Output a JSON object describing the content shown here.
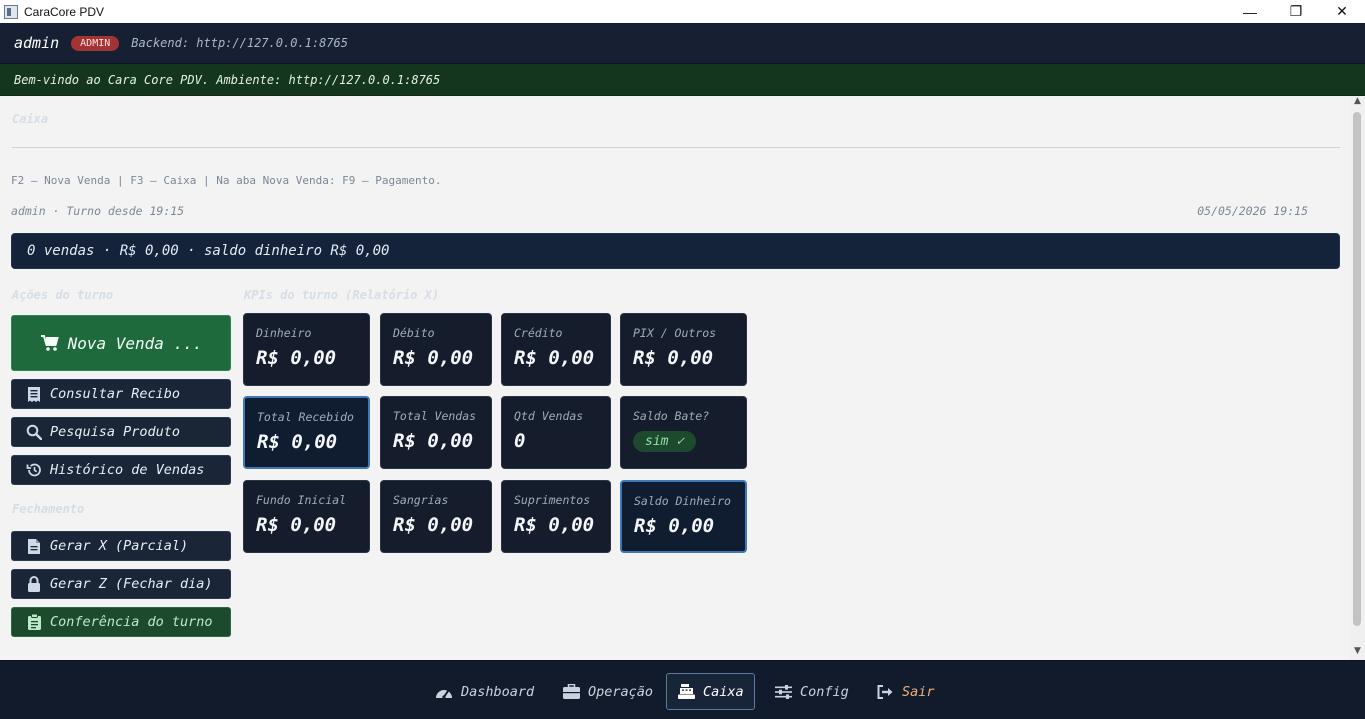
{
  "window": {
    "title": "CaraCore PDV",
    "minimize": "—",
    "maximize": "❐",
    "close": "✕"
  },
  "header": {
    "user": "admin",
    "role": "ADMIN",
    "backend": "Backend: http://127.0.0.1:8765"
  },
  "welcome": "Bem-vindo ao Cara Core PDV. Ambiente: http://127.0.0.1:8765",
  "page": {
    "title": "Caixa",
    "hint": "F2 — Nova Venda | F3 — Caixa | Na aba Nova Venda: F9 — Pagamento.",
    "shift": "admin  ·  Turno desde 19:15",
    "datetime": "05/05/2026 19:15",
    "summary": "0 vendas · R$ 0,00 · saldo dinheiro R$ 0,00"
  },
  "actions": {
    "section": "Ações do turno",
    "nova_venda": "Nova Venda ...",
    "consultar_recibo": "Consultar Recibo",
    "pesquisa_produto": "Pesquisa Produto",
    "historico": "Histórico de Vendas"
  },
  "closing": {
    "section": "Fechamento",
    "gerar_x": "Gerar X (Parcial)",
    "gerar_z": "Gerar Z (Fechar dia)",
    "conferencia": "Conferência do turno"
  },
  "kpis": {
    "section": "KPIs do turno (Relatório X)",
    "dinheiro": {
      "label": "Dinheiro",
      "value": "R$ 0,00"
    },
    "debito": {
      "label": "Débito",
      "value": "R$ 0,00"
    },
    "credito": {
      "label": "Crédito",
      "value": "R$ 0,00"
    },
    "pix": {
      "label": "PIX / Outros",
      "value": "R$ 0,00"
    },
    "total_recebido": {
      "label": "Total Recebido",
      "value": "R$ 0,00"
    },
    "total_vendas": {
      "label": "Total Vendas",
      "value": "R$ 0,00"
    },
    "qtd_vendas": {
      "label": "Qtd Vendas",
      "value": "0"
    },
    "saldo_bate": {
      "label": "Saldo Bate?",
      "value": "sim ✓"
    },
    "fundo_inicial": {
      "label": "Fundo Inicial",
      "value": "R$ 0,00"
    },
    "sangrias": {
      "label": "Sangrias",
      "value": "R$ 0,00"
    },
    "suprimentos": {
      "label": "Suprimentos",
      "value": "R$ 0,00"
    },
    "saldo_dinheiro": {
      "label": "Saldo Dinheiro",
      "value": "R$ 0,00"
    }
  },
  "nav": {
    "dashboard": "Dashboard",
    "operacao": "Operação",
    "caixa": "Caixa",
    "config": "Config",
    "sair": "Sair"
  },
  "colors": {
    "header_bg": "#172033",
    "welcome_bg": "#14361f",
    "primary_green": "#1f6a3c",
    "role_badge": "#a33434",
    "highlight_border": "#3f78b8",
    "exit_accent": "#f0b07a"
  },
  "icons": {
    "cart": "cart-icon",
    "receipt": "receipt-icon",
    "search": "search-icon",
    "history": "history-icon",
    "file": "file-icon",
    "lock": "lock-icon",
    "clipboard": "clipboard-icon",
    "dashboard": "gauge-icon",
    "operacao": "briefcase-icon",
    "caixa": "cash-register-icon",
    "config": "sliders-icon",
    "sair": "sign-out-icon"
  }
}
